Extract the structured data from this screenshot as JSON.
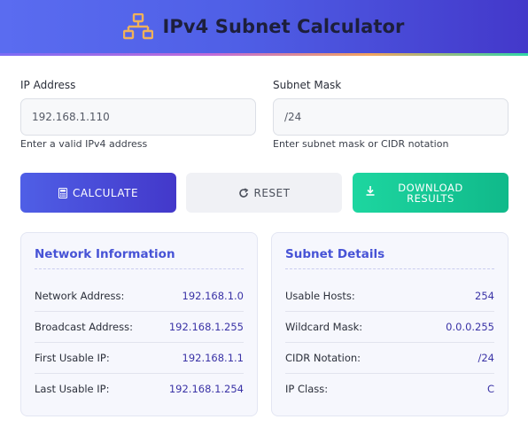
{
  "header": {
    "title": "IPv4 Subnet Calculator",
    "logo_icon": "network-icon"
  },
  "form": {
    "ip": {
      "label": "IP Address",
      "value": "192.168.1.110",
      "hint": "Enter a valid IPv4 address"
    },
    "mask": {
      "label": "Subnet Mask",
      "value": "/24",
      "hint": "Enter subnet mask or CIDR notation"
    }
  },
  "buttons": {
    "calculate": {
      "label": "CALCULATE",
      "icon": "calculator-icon"
    },
    "reset": {
      "label": "RESET",
      "icon": "refresh-icon"
    },
    "download": {
      "line1": "DOWNLOAD",
      "line2": "RESULTS",
      "icon": "download-icon"
    }
  },
  "network_info": {
    "title": "Network Information",
    "rows": [
      {
        "key": "Network Address:",
        "value": "192.168.1.0"
      },
      {
        "key": "Broadcast Address:",
        "value": "192.168.1.255"
      },
      {
        "key": "First Usable IP:",
        "value": "192.168.1.1"
      },
      {
        "key": "Last Usable IP:",
        "value": "192.168.1.254"
      }
    ]
  },
  "subnet_details": {
    "title": "Subnet Details",
    "rows": [
      {
        "key": "Usable Hosts:",
        "value": "254"
      },
      {
        "key": "Wildcard Mask:",
        "value": "0.0.0.255"
      },
      {
        "key": "CIDR Notation:",
        "value": "/24"
      },
      {
        "key": "IP Class:",
        "value": "C"
      }
    ]
  },
  "colors": {
    "accent": "#4f5fe6",
    "accent_dark": "#4338ca",
    "success": "#10b98a",
    "logo": "#f0b15a"
  }
}
